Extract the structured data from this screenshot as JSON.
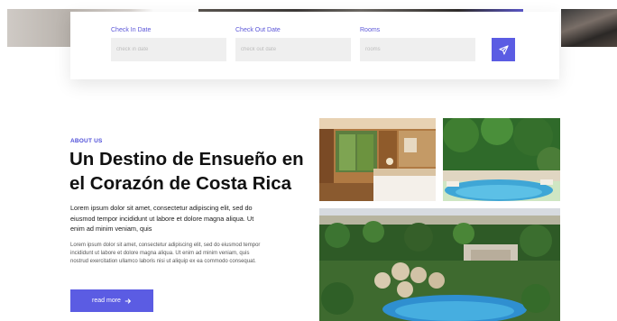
{
  "booking": {
    "check_in": {
      "label": "Check In Date",
      "placeholder": "check in date"
    },
    "check_out": {
      "label": "Check Out Date",
      "placeholder": "check out date"
    },
    "rooms": {
      "label": "Rooms",
      "placeholder": "rooms"
    },
    "submit_icon": "send-icon"
  },
  "about": {
    "tag": "ABOUT US",
    "title_line1": "Un Destino de Ensueño en",
    "title_line2": "el Corazón de Costa Rica",
    "lead": "Lorem ipsum dolor sit amet, consectetur adipiscing elit, sed do eiusmod tempor incididunt ut labore et dolore magna aliqua. Ut enim ad minim veniam, quis",
    "body": "Lorem ipsum dolor sit amet, consectetur adipiscing elit, sed do eiusmod tempor incididunt ut labore et dolore magna aliqua. Ut enim ad minim veniam, quis nostrud exercitation ullamco laboris nisi ut aliquip ex ea commodo consequat.",
    "button_label": "read more",
    "button_icon": "arrow-right-icon"
  },
  "colors": {
    "accent": "#5b5ce3"
  }
}
